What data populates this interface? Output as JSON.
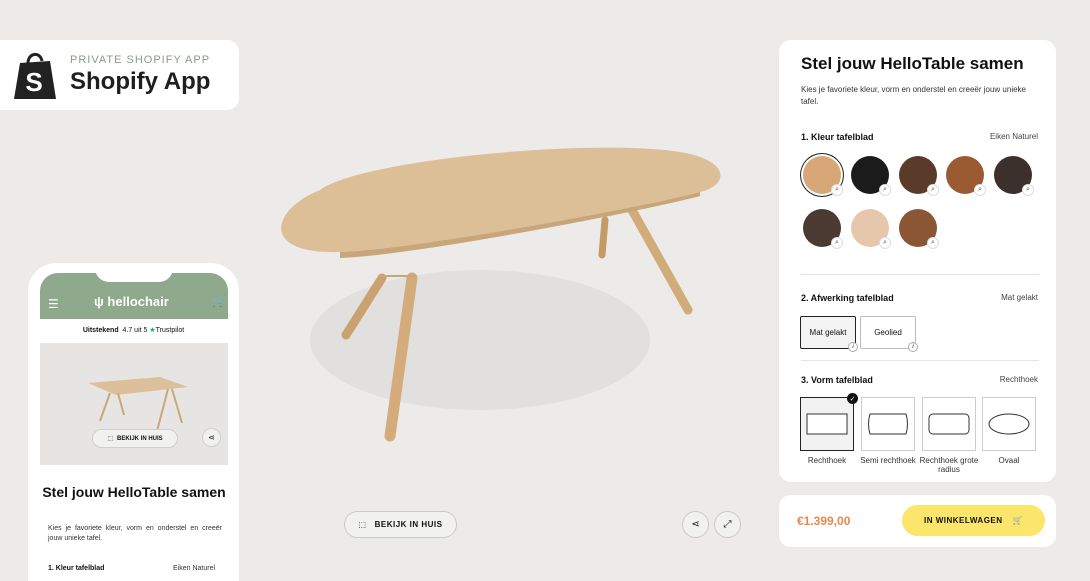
{
  "badge": {
    "sub": "PRIVATE SHOPIFY APP",
    "title": "Shopify App"
  },
  "phone": {
    "brand": "hellochair",
    "trust_rating_word": "Uitstekend",
    "trust_score": "4.7 uit 5",
    "trust_brand": "Trustpilot",
    "view_label": "BEKIJK IN HUIS",
    "title": "Stel jouw HelloTable samen",
    "description": "Kies je favoriete kleur, vorm en onderstel en creeër jouw unieke tafel.",
    "step_label": "1. Kleur tafelblad",
    "step_value": "Eiken Naturel"
  },
  "viewer": {
    "view_in_room": "BEKIJK IN HUIS"
  },
  "panel": {
    "title": "Stel jouw HelloTable samen",
    "description": "Kies je favoriete kleur, vorm en onderstel en creeër jouw unieke tafel.",
    "step1": {
      "label": "1. Kleur tafelblad",
      "value": "Eiken Naturel"
    },
    "step2": {
      "label": "2. Afwerking tafelblad",
      "value": "Mat gelakt",
      "options": [
        "Mat gelakt",
        "Geolied"
      ]
    },
    "step3": {
      "label": "3. Vorm tafelblad",
      "value": "Rechthoek",
      "options": [
        "Rechthoek",
        "Semi rechthoek",
        "Rechthoek grote radius",
        "Ovaal"
      ]
    },
    "swatch_colors": [
      "#d7a778",
      "#1b1b1b",
      "#5a3b2a",
      "#9a5a32",
      "#3b302c",
      "#4a3a31",
      "#e7c7ab",
      "#8a5634"
    ]
  },
  "cart": {
    "price": "€1.399,00",
    "button": "IN WINKELWAGEN"
  }
}
